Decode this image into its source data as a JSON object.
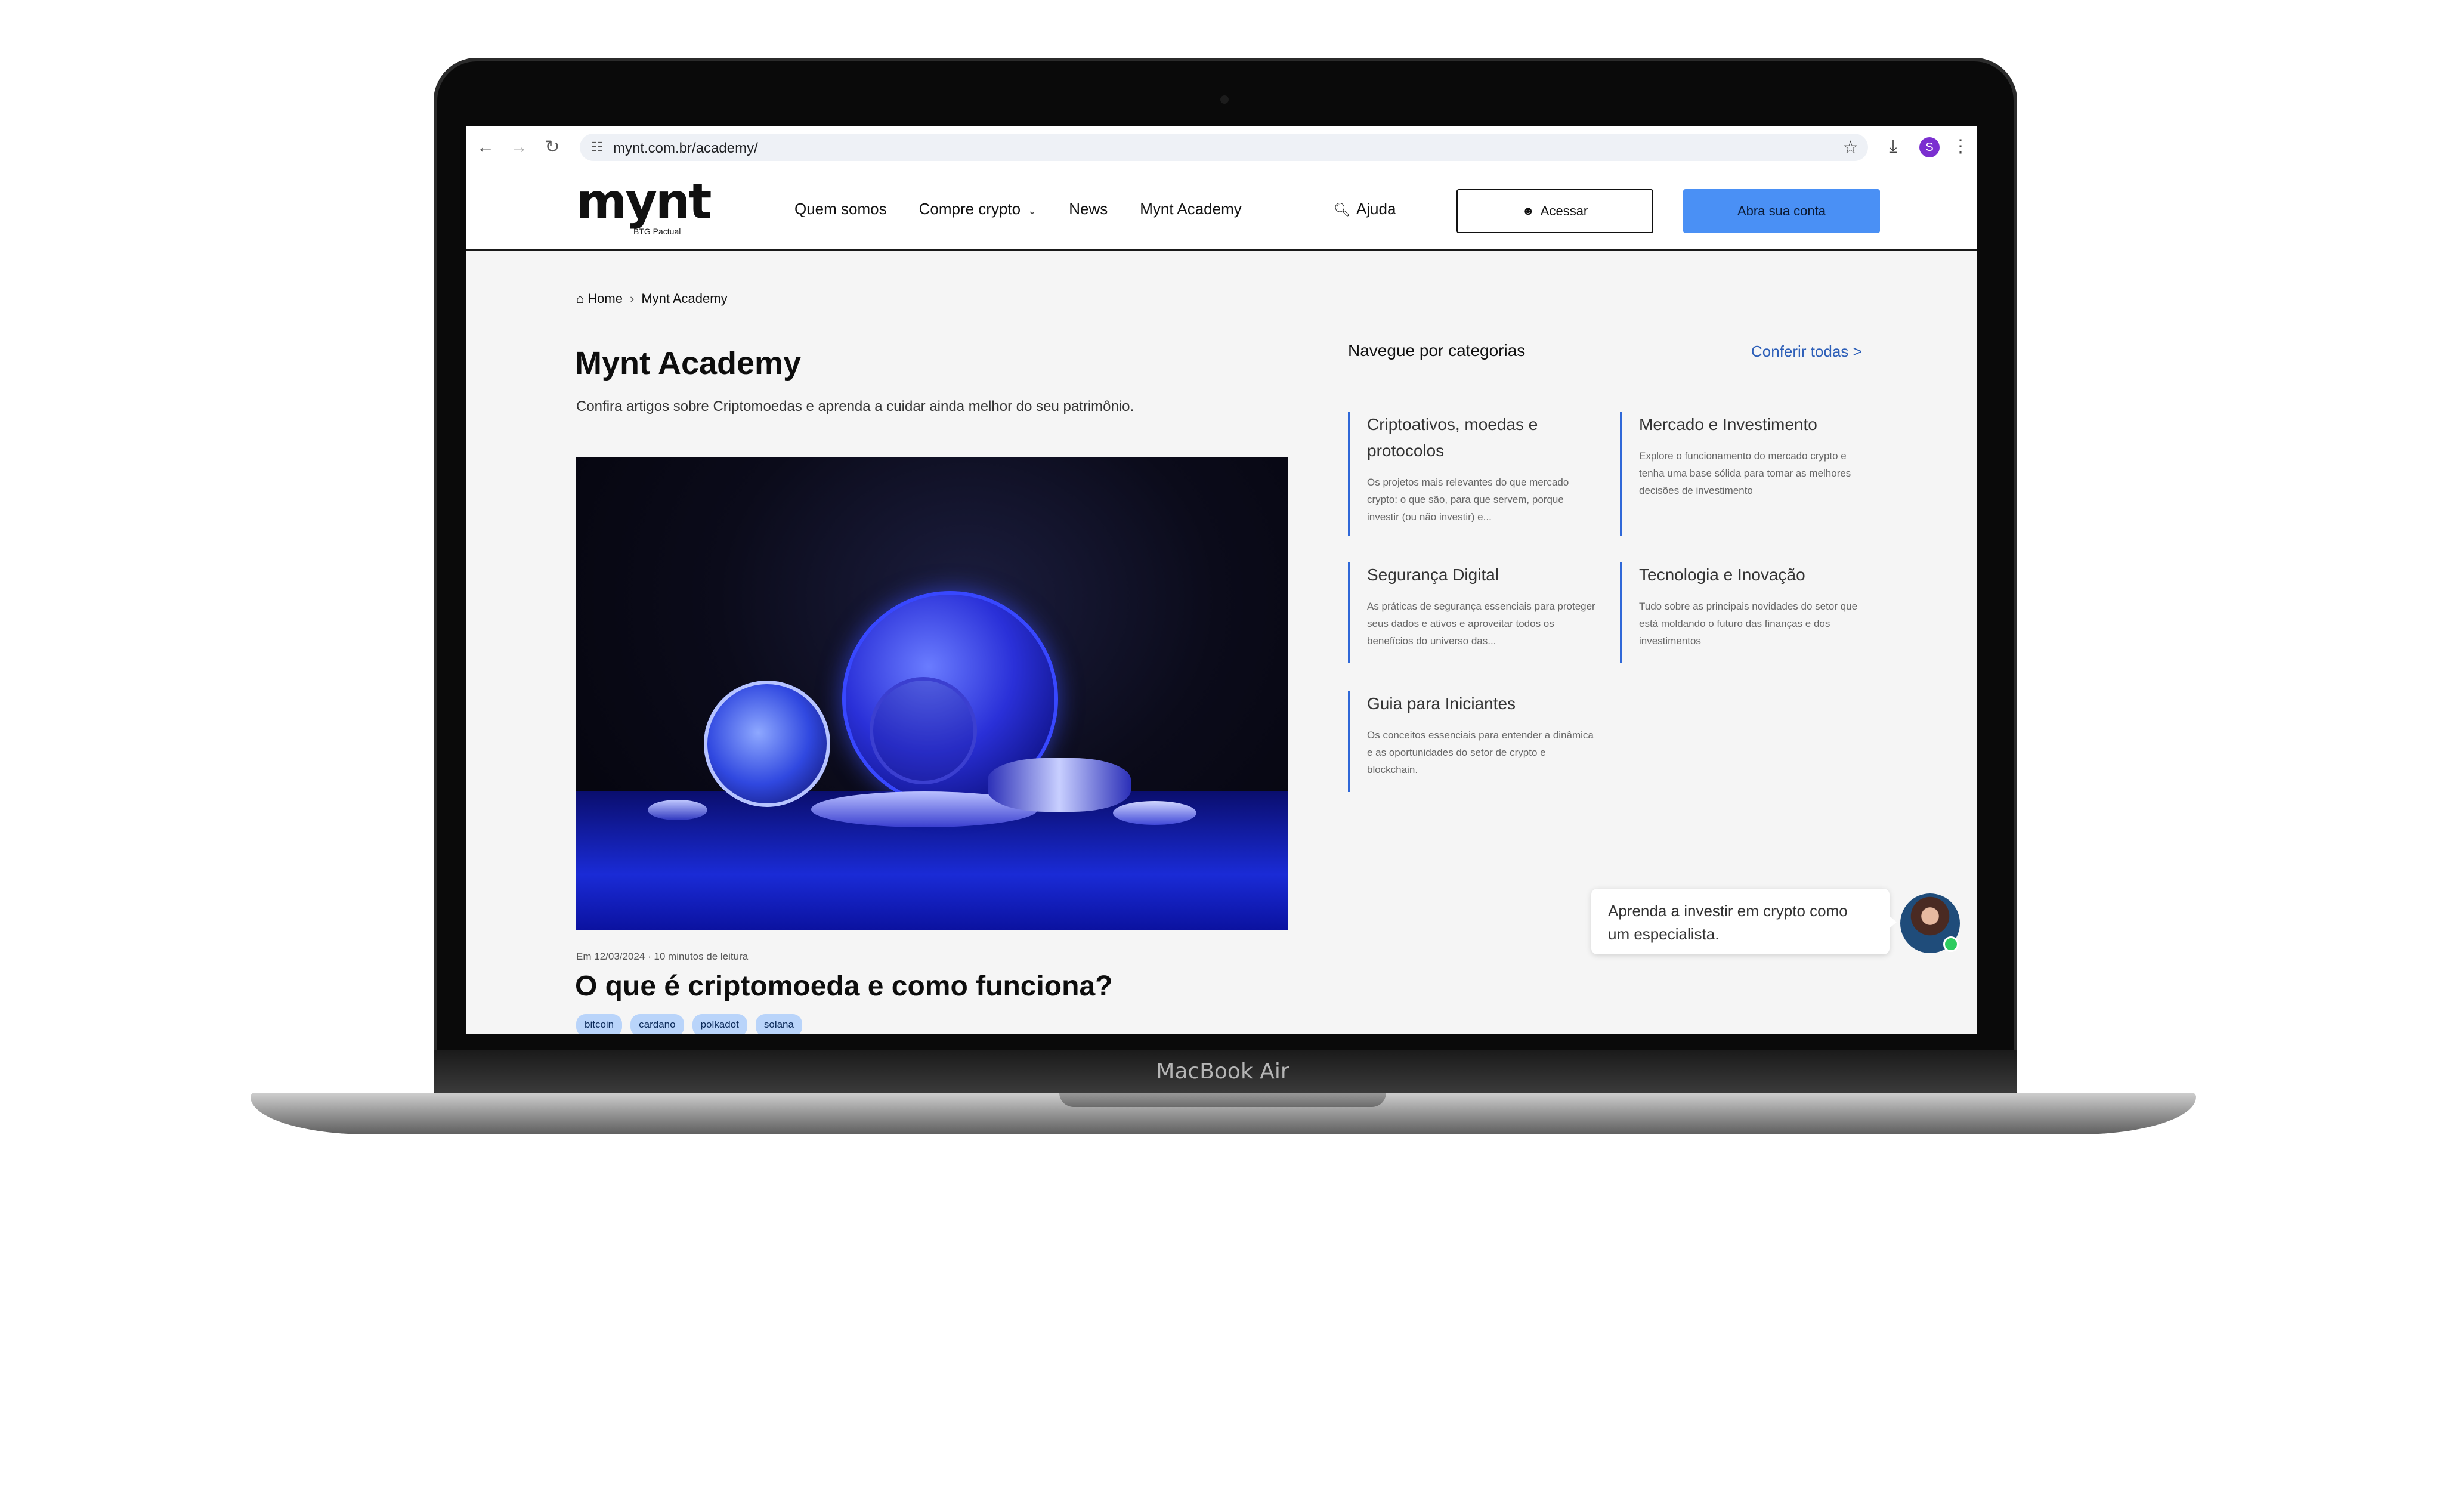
{
  "device": {
    "label": "MacBook Air"
  },
  "browser": {
    "url": "mynt.com.br/academy/",
    "profile_initial": "S",
    "icons": {
      "back": "arrow-left-icon",
      "forward": "arrow-right-icon",
      "reload": "reload-icon",
      "site_info": "tune-icon",
      "bookmark": "star-icon",
      "download": "download-icon",
      "menu": "kebab-menu-icon"
    }
  },
  "header": {
    "logo": {
      "word": "mynt",
      "sub": "BTG Pactual"
    },
    "nav": [
      {
        "label": "Quem somos"
      },
      {
        "label": "Compre crypto",
        "dropdown": true
      },
      {
        "label": "News"
      },
      {
        "label": "Mynt Academy"
      }
    ],
    "help_label": "Ajuda",
    "login_label": "Acessar",
    "cta_label": "Abra sua conta",
    "colors": {
      "cta_bg": "#4a90f5",
      "border": "#1a1a1a"
    }
  },
  "breadcrumb": {
    "home": "Home",
    "current": "Mynt Academy"
  },
  "hero": {
    "title": "Mynt Academy",
    "subtitle": "Confira artigos sobre Criptomoedas e aprenda a cuidar ainda melhor do seu patrimônio."
  },
  "featured_article": {
    "meta": "Em 12/03/2024 · 10 minutos de leitura",
    "title": "O que é criptomoeda e como funciona?",
    "tags": [
      "bitcoin",
      "cardano",
      "polkadot",
      "solana"
    ]
  },
  "categories": {
    "heading": "Navegue por categorias",
    "see_all": "Conferir todas >",
    "accent": "#2f68d8",
    "items": [
      {
        "title": "Criptoativos, moedas e protocolos",
        "desc": "Os projetos mais relevantes do que mercado crypto: o que são, para que servem, porque investir (ou não investir) e..."
      },
      {
        "title": "Mercado e Investimento",
        "desc": "Explore o funcionamento do mercado crypto e tenha uma base sólida para tomar as melhores decisões de investimento"
      },
      {
        "title": "Segurança Digital",
        "desc": "As práticas de segurança essenciais para proteger seus dados e ativos e aproveitar todos os benefícios do universo das..."
      },
      {
        "title": "Tecnologia e Inovação",
        "desc": "Tudo sobre as principais novidades do setor que está moldando o futuro das finanças e dos investimentos"
      },
      {
        "title": "Guia para Iniciantes",
        "desc": "Os conceitos essenciais para entender a dinâmica e as oportunidades do setor de crypto e blockchain."
      }
    ]
  },
  "chat": {
    "message": "Aprenda a investir em crypto como um especialista.",
    "status_color": "#2ecc5f"
  }
}
